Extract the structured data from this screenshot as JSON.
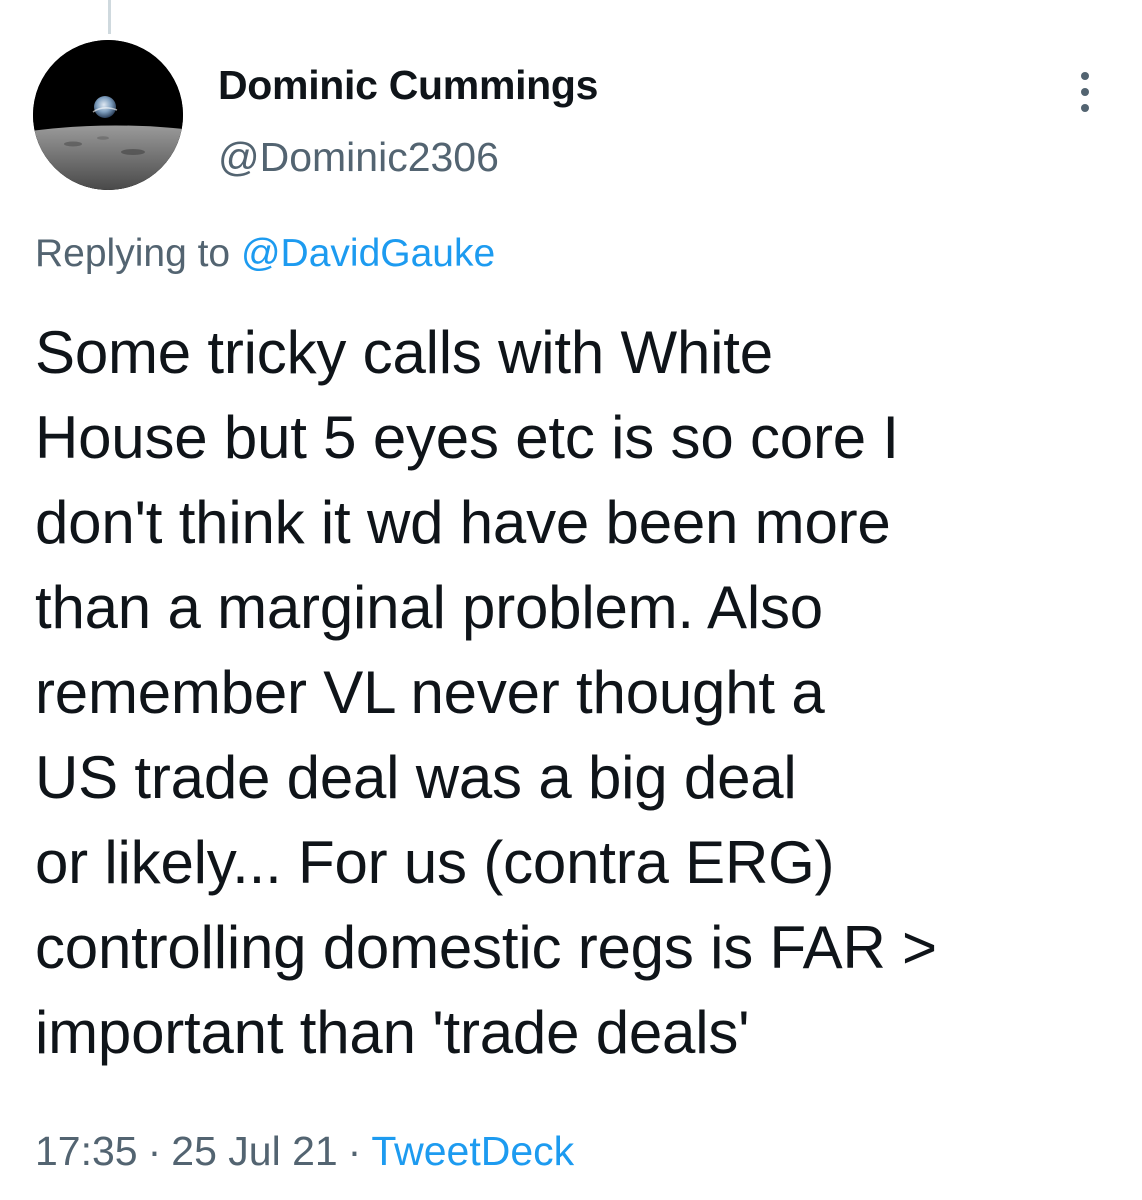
{
  "tweet": {
    "author_name": "Dominic Cummings",
    "author_handle": "@Dominic2306",
    "replying_prefix": "Replying to",
    "replying_to": "@DavidGauke",
    "text_lines": [
      "Some tricky calls with White",
      "House but 5 eyes etc is so core I",
      "don't think it wd have been more",
      "than a marginal problem. Also",
      "remember VL never thought a",
      "US trade deal was a big deal",
      "or likely... For us (contra ERG)",
      "controlling domestic regs is FAR >",
      "important than 'trade deals'"
    ],
    "time": "17:35",
    "separator": "·",
    "date": "25 Jul 21",
    "source": "TweetDeck"
  },
  "icons": {
    "avatar": "earthrise-avatar",
    "more": "more-options-icon"
  },
  "colors": {
    "text": "#0f1419",
    "secondary": "#536471",
    "link": "#1d9bf0"
  }
}
